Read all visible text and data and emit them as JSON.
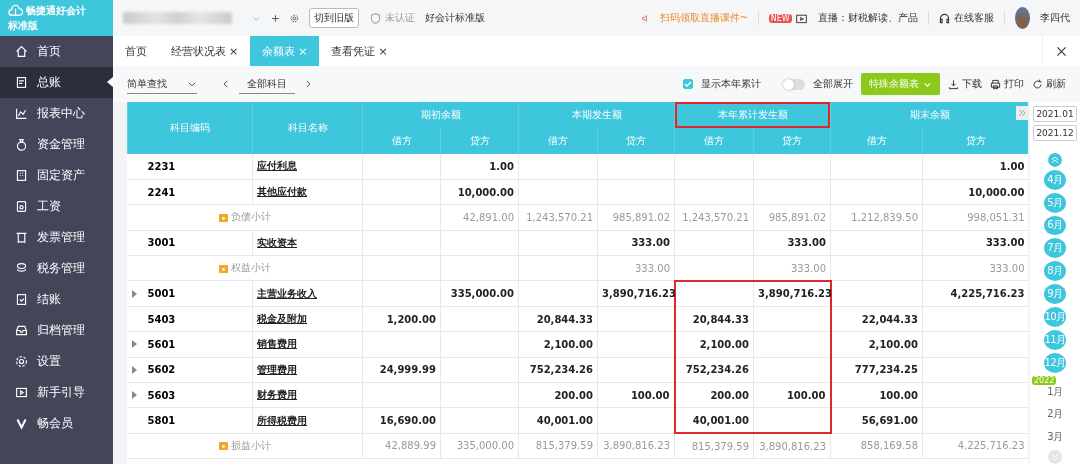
{
  "brand": {
    "name": "畅捷通好会计",
    "edition": "标准版"
  },
  "topbar": {
    "switch_button": "切到旧版",
    "cert_status": "未认证",
    "product": "好会计标准版",
    "promo": "扫码领取直播课件~",
    "new_badge": "NEW",
    "live": "直播：财税解读、产品",
    "support": "在线客服",
    "user": "李四代"
  },
  "sidebar": {
    "items": [
      {
        "label": "首页",
        "selected": false
      },
      {
        "label": "总账",
        "selected": true
      },
      {
        "label": "报表中心",
        "selected": false
      },
      {
        "label": "资金管理",
        "selected": false
      },
      {
        "label": "固定资产",
        "selected": false
      },
      {
        "label": "工资",
        "selected": false
      },
      {
        "label": "发票管理",
        "selected": false
      },
      {
        "label": "税务管理",
        "selected": false
      },
      {
        "label": "结账",
        "selected": false
      },
      {
        "label": "归档管理",
        "selected": false
      },
      {
        "label": "设置",
        "selected": false
      },
      {
        "label": "新手引导",
        "selected": false
      },
      {
        "label": "畅会员",
        "selected": false
      }
    ]
  },
  "tabs": [
    {
      "label": "首页",
      "selected": false
    },
    {
      "label": "经营状况表",
      "close": "×",
      "selected": false
    },
    {
      "label": "余额表",
      "close": "×",
      "selected": true
    },
    {
      "label": "查看凭证",
      "close": "×",
      "selected": false
    }
  ],
  "toolbar": {
    "search_mode": "简单查找",
    "subject": "全部科目",
    "show_ytd": {
      "label": "显示本年累计",
      "checked": true
    },
    "expand_all": {
      "label": "全部展开",
      "on": false
    },
    "special_button": "特殊余额表",
    "actions": [
      "下载",
      "打印",
      "刷新"
    ]
  },
  "table": {
    "columns": [
      "科目编码",
      "科目名称"
    ],
    "groups": [
      {
        "label": "期初余额",
        "outlined": false,
        "sub": [
          "借方",
          "贷方"
        ]
      },
      {
        "label": "本期发生额",
        "outlined": false,
        "sub": [
          "借方",
          "贷方"
        ]
      },
      {
        "label": "本年累计发生额",
        "outlined": true,
        "sub": [
          "借方",
          "贷方"
        ]
      },
      {
        "label": "期末余额",
        "outlined": false,
        "sub": [
          "借方",
          "贷方"
        ]
      }
    ],
    "rows": [
      {
        "kind": "account",
        "code": "2231",
        "name": "应付利息",
        "expandable": false,
        "ytd_outlined": false,
        "values": {
          "opening_credit": "1.00",
          "closing_credit": "1.00"
        }
      },
      {
        "kind": "account",
        "code": "2241",
        "name": "其他应付款",
        "expandable": false,
        "ytd_outlined": false,
        "values": {
          "opening_credit": "10,000.00",
          "closing_credit": "10,000.00"
        }
      },
      {
        "kind": "subtotal",
        "name": "负债小计",
        "ytd_outlined": false,
        "values": {
          "opening_credit": "42,891.00",
          "period_debit": "1,243,570.21",
          "period_credit": "985,891.02",
          "ytd_debit": "1,243,570.21",
          "ytd_credit": "985,891.02",
          "closing_debit": "1,212,839.50",
          "closing_credit": "998,051.31"
        }
      },
      {
        "kind": "account",
        "code": "3001",
        "name": "实收资本",
        "expandable": false,
        "ytd_outlined": false,
        "values": {
          "period_credit": "333.00",
          "ytd_credit": "333.00",
          "closing_credit": "333.00"
        }
      },
      {
        "kind": "subtotal",
        "name": "权益小计",
        "ytd_outlined": false,
        "values": {
          "period_credit": "333.00",
          "ytd_credit": "333.00",
          "closing_credit": "333.00"
        }
      },
      {
        "kind": "account",
        "code": "5001",
        "name": "主营业务收入",
        "expandable": true,
        "ytd_outlined": true,
        "values": {
          "opening_credit": "335,000.00",
          "period_credit": "3,890,716.23",
          "ytd_credit": "3,890,716.23",
          "closing_credit": "4,225,716.23"
        }
      },
      {
        "kind": "account",
        "code": "5403",
        "name": "税金及附加",
        "expandable": false,
        "ytd_outlined": true,
        "values": {
          "opening_debit": "1,200.00",
          "period_debit": "20,844.33",
          "ytd_debit": "20,844.33",
          "closing_debit": "22,044.33"
        }
      },
      {
        "kind": "account",
        "code": "5601",
        "name": "销售费用",
        "expandable": true,
        "ytd_outlined": true,
        "values": {
          "period_debit": "2,100.00",
          "ytd_debit": "2,100.00",
          "closing_debit": "2,100.00"
        }
      },
      {
        "kind": "account",
        "code": "5602",
        "name": "管理费用",
        "expandable": true,
        "ytd_outlined": true,
        "values": {
          "opening_debit": "24,999.99",
          "period_debit": "752,234.26",
          "ytd_debit": "752,234.26",
          "closing_debit": "777,234.25"
        }
      },
      {
        "kind": "account",
        "code": "5603",
        "name": "财务费用",
        "expandable": true,
        "ytd_outlined": true,
        "values": {
          "period_debit": "200.00",
          "period_credit": "100.00",
          "ytd_debit": "200.00",
          "ytd_credit": "100.00",
          "closing_debit": "100.00"
        }
      },
      {
        "kind": "account",
        "code": "5801",
        "name": "所得税费用",
        "expandable": false,
        "ytd_outlined": true,
        "values": {
          "opening_debit": "16,690.00",
          "period_debit": "40,001.00",
          "ytd_debit": "40,001.00",
          "closing_debit": "56,691.00"
        }
      },
      {
        "kind": "subtotal",
        "name": "损益小计",
        "ytd_outlined": false,
        "values": {
          "opening_debit": "42,889.99",
          "opening_credit": "335,000.00",
          "period_debit": "815,379.59",
          "period_credit": "3,890,816.23",
          "ytd_debit": "815,379.59",
          "ytd_credit": "3,890,816.23",
          "closing_debit": "858,169.58",
          "closing_credit": "4,225,716.23"
        }
      }
    ]
  },
  "period": {
    "start": "2021.01",
    "end": "2021.12",
    "year_badge": "2022",
    "months": [
      {
        "label": "4月",
        "in_range": true
      },
      {
        "label": "5月",
        "in_range": true
      },
      {
        "label": "6月",
        "in_range": true
      },
      {
        "label": "7月",
        "in_range": true
      },
      {
        "label": "8月",
        "in_range": true
      },
      {
        "label": "9月",
        "in_range": true
      },
      {
        "label": "10月",
        "in_range": true
      },
      {
        "label": "11月",
        "in_range": true
      },
      {
        "label": "12月",
        "in_range": true
      },
      {
        "label": "1月",
        "in_range": false
      },
      {
        "label": "2月",
        "in_range": false
      },
      {
        "label": "3月",
        "in_range": false
      }
    ]
  }
}
